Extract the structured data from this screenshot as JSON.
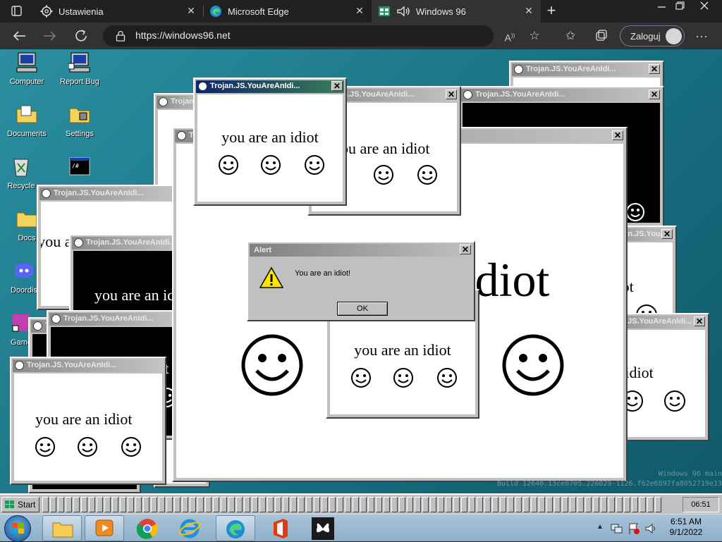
{
  "browser": {
    "tabs": [
      {
        "label": "Ustawienia",
        "icon": "gear-icon"
      },
      {
        "label": "Microsoft Edge",
        "icon": "edge-icon"
      },
      {
        "label": "Windows 96",
        "icon": "windows96-icon",
        "active": true
      }
    ],
    "new_tab": "+",
    "url": "https://windows96.net",
    "login_label": "Zaloguj",
    "colors": {
      "chrome_dark": "#202020",
      "toolbar": "#323232",
      "accent_login_border": "#6d7e96"
    }
  },
  "desktop": {
    "icons": [
      {
        "label": "Computer",
        "icon": "computer-icon"
      },
      {
        "label": "Report Bug",
        "icon": "report-bug-icon"
      },
      {
        "label": "Documents",
        "icon": "documents-folder-icon"
      },
      {
        "label": "Settings",
        "icon": "settings-icon"
      },
      {
        "label": "Recycle",
        "icon": "recycle-bin-icon"
      },
      {
        "label": "",
        "icon": "terminal-icon"
      },
      {
        "label": "Docs",
        "icon": "folder-icon"
      },
      {
        "label": "Doordis",
        "icon": "discord-icon"
      },
      {
        "label": "Game",
        "icon": "game-icon"
      }
    ],
    "popup_title": "Trojan.JS.YouAreAnIdi...",
    "popup_text": "you are an idiot",
    "big_text": "you are an idiot",
    "alert": {
      "title": "Alert",
      "message": "You are an idiot!",
      "ok_label": "OK"
    },
    "build_info": {
      "line1": "Windows 96 main",
      "line2": "Build 12640.13ce0705.220829-1126.f62e6897fa8052719e13"
    },
    "colors": {
      "desktop_teal": "#1f7b8c",
      "active_titlebar": "#0a246a",
      "window_gray": "#c0c0c0"
    }
  },
  "w96_taskbar": {
    "start_label": "Start",
    "clock": "06:51"
  },
  "win7_taskbar": {
    "apps": [
      "windows-explorer-icon",
      "media-player-icon",
      "chrome-icon",
      "internet-explorer-icon",
      "edge-icon",
      "office-icon",
      "butterfly-app-icon"
    ],
    "time": "6:51 AM",
    "date": "9/1/2022"
  }
}
